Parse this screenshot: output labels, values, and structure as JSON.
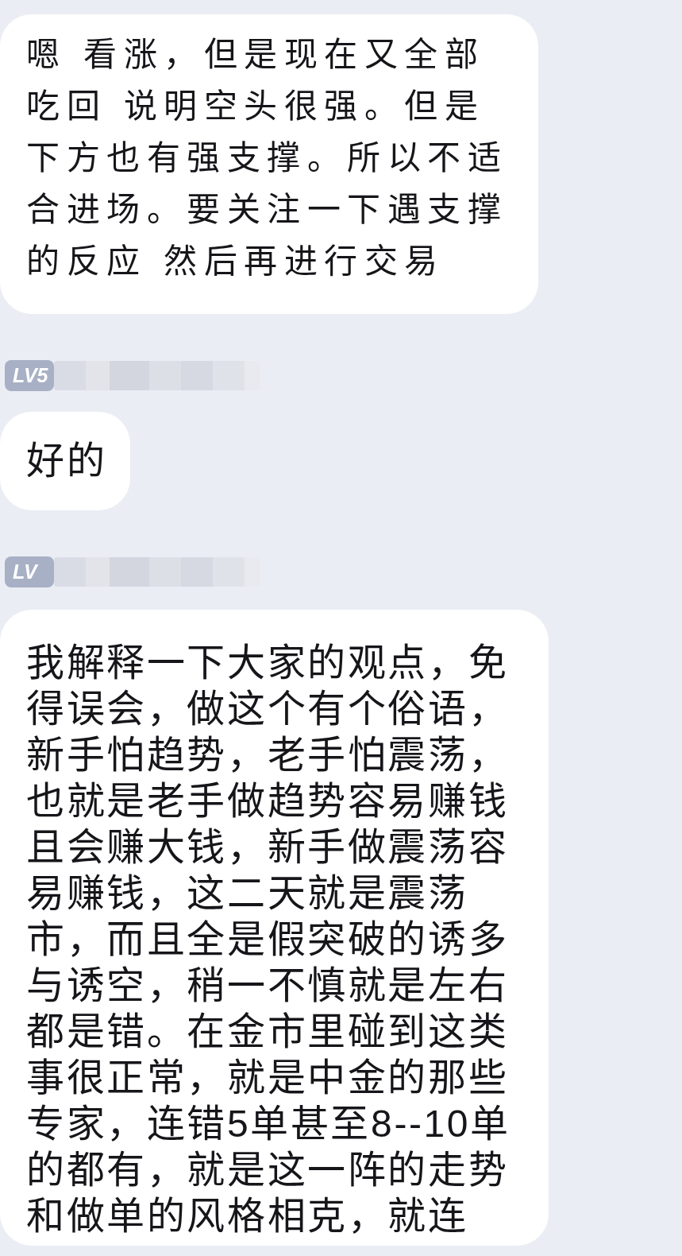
{
  "messages": [
    {
      "kind": "handwritten",
      "text": "嗯 看涨，但是现在又全部吃回 说明空头很强。但是下方也有强支撑。所以不适合进场。要关注一下遇支撑的反应 然后再进行交易"
    },
    {
      "kind": "sender",
      "badge": "LV5"
    },
    {
      "kind": "bubble",
      "text": "好的"
    },
    {
      "kind": "sender",
      "badge": "LV"
    },
    {
      "kind": "bubble",
      "text": "我解释一下大家的观点，免得误会，做这个有个俗语，新手怕趋势，老手怕震荡，也就是老手做趋势容易赚钱且会赚大钱，新手做震荡容易赚钱，这二天就是震荡市，而且全是假突破的诱多与诱空，稍一不慎就是左右都是错。在金市里碰到这类事很正常，就是中金的那些专家，连错5单甚至8--10单的都有，就是这一阵的走势和做单的风格相克，就连"
    }
  ]
}
